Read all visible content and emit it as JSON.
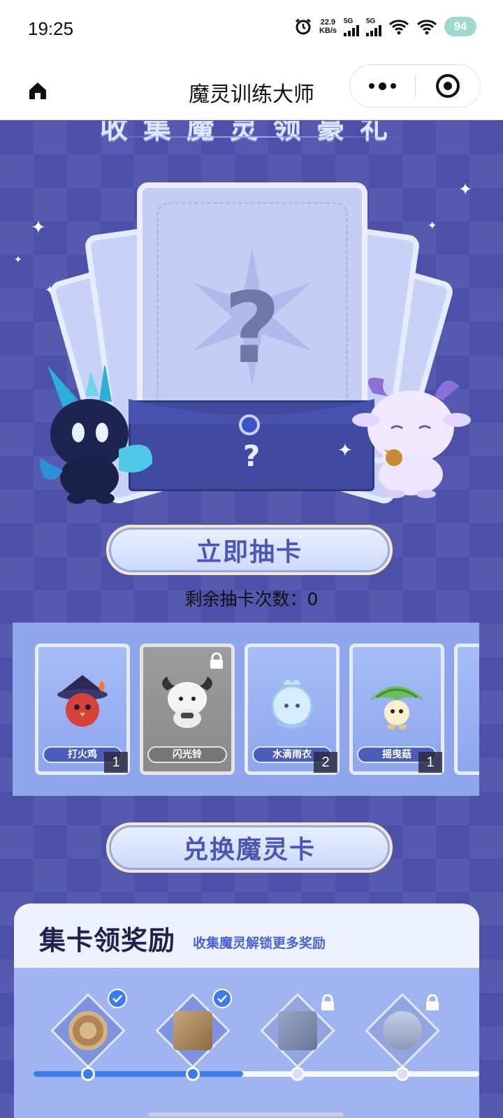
{
  "status_bar": {
    "time": "19:25",
    "speed_value": "22.9",
    "speed_unit": "KB/s",
    "sim1": "5G",
    "sim2": "5G",
    "battery": "94",
    "icons": [
      "alarm-icon",
      "signal-icon",
      "signal-icon",
      "wifi-icon",
      "wifi-icon",
      "battery-icon"
    ]
  },
  "title_bar": {
    "title": "魔灵训练大师",
    "icons": [
      "home-icon",
      "more-icon",
      "close-target-icon"
    ]
  },
  "banner": {
    "title": "收集魔灵领豪礼"
  },
  "draw": {
    "mystery_mark": "?",
    "envelope_mark": "?",
    "button_label": "立即抽卡",
    "remaining_label": "剩余抽卡次数：",
    "remaining_count": "0"
  },
  "cards": [
    {
      "name": "打火鸡",
      "count": "1",
      "locked": false,
      "color": "#d8403a"
    },
    {
      "name": "闪光铃",
      "count": "",
      "locked": true,
      "color": "#f0f0f0"
    },
    {
      "name": "水滴雨衣",
      "count": "2",
      "locked": false,
      "color": "#d6ecff"
    },
    {
      "name": "摇曳菇",
      "count": "1",
      "locked": false,
      "color": "#7cc06a"
    }
  ],
  "exchange": {
    "button_label": "兑换魔灵卡"
  },
  "rewards": {
    "title": "集卡领奖励",
    "subtitle": "收集魔灵解锁更多奖励",
    "progress": 0.47,
    "items": [
      {
        "state": "claimed",
        "icon": "cookie-icon"
      },
      {
        "state": "claimed",
        "icon": "scroll-icon"
      },
      {
        "state": "locked",
        "icon": "book-icon"
      },
      {
        "state": "locked",
        "icon": "hourglass-icon"
      }
    ]
  },
  "colors": {
    "accent": "#3b7bf0",
    "background": "#4b4fa6",
    "button_text": "#4b56b6"
  }
}
